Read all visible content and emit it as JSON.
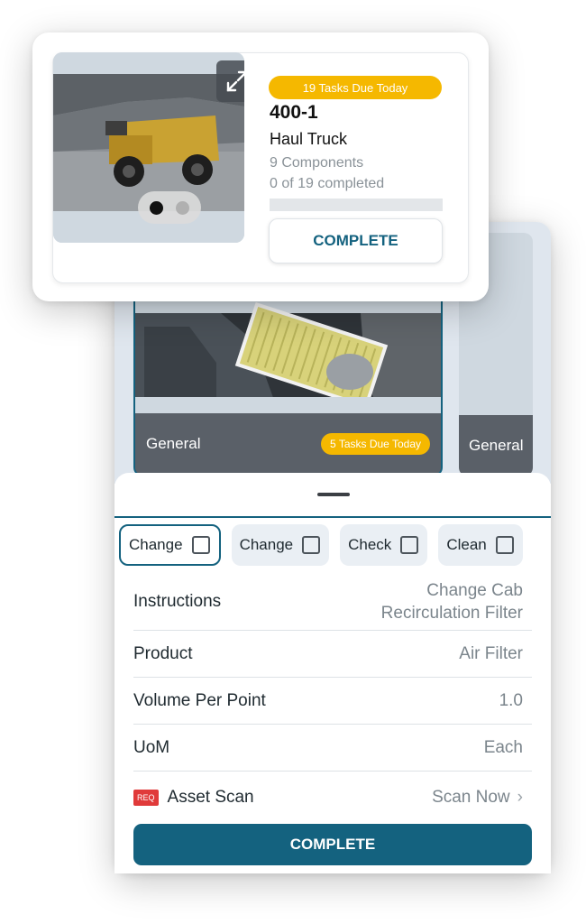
{
  "asset_card": {
    "due_badge": "19 Tasks Due Today",
    "asset_id": "400-1",
    "asset_type": "Haul Truck",
    "components": "9 Components",
    "progress_text": "0 of 19 completed",
    "progress_fraction": 0,
    "complete_label": "COMPLETE",
    "carousel_pages": 2,
    "carousel_active": 1
  },
  "components": [
    {
      "title": "General",
      "badge": "5 Tasks Due Today"
    },
    {
      "title": "General",
      "badge": ""
    }
  ],
  "tasks": [
    {
      "label": "Change",
      "checked": false,
      "selected": true
    },
    {
      "label": "Change",
      "checked": false,
      "selected": false
    },
    {
      "label": "Check",
      "checked": false,
      "selected": false
    },
    {
      "label": "Clean",
      "checked": false,
      "selected": false
    }
  ],
  "details": {
    "instructions_label": "Instructions",
    "instructions_value_line1": "Change Cab",
    "instructions_value_line2": "Recirculation Filter",
    "product_label": "Product",
    "product_value": "Air Filter",
    "volume_label": "Volume Per Point",
    "volume_value": "1.0",
    "uom_label": "UoM",
    "uom_value": "Each",
    "req_tag": "REQ",
    "scan_label": "Asset Scan",
    "scan_value": "Scan Now"
  },
  "main_complete_label": "COMPLETE",
  "colors": {
    "brand": "#14627f",
    "badge": "#f5b800",
    "required": "#e03a3a"
  }
}
